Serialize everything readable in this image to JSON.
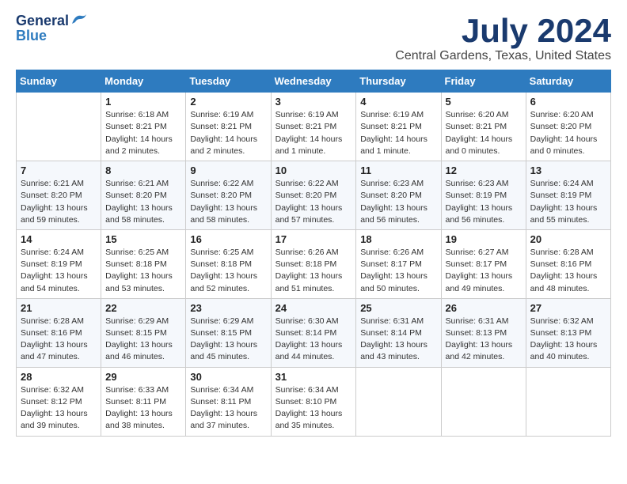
{
  "logo": {
    "line1": "General",
    "line2": "Blue"
  },
  "title": {
    "month_year": "July 2024",
    "location": "Central Gardens, Texas, United States"
  },
  "days_of_week": [
    "Sunday",
    "Monday",
    "Tuesday",
    "Wednesday",
    "Thursday",
    "Friday",
    "Saturday"
  ],
  "weeks": [
    [
      {
        "day": "",
        "sunrise": "",
        "sunset": "",
        "daylight": ""
      },
      {
        "day": "1",
        "sunrise": "Sunrise: 6:18 AM",
        "sunset": "Sunset: 8:21 PM",
        "daylight": "Daylight: 14 hours and 2 minutes."
      },
      {
        "day": "2",
        "sunrise": "Sunrise: 6:19 AM",
        "sunset": "Sunset: 8:21 PM",
        "daylight": "Daylight: 14 hours and 2 minutes."
      },
      {
        "day": "3",
        "sunrise": "Sunrise: 6:19 AM",
        "sunset": "Sunset: 8:21 PM",
        "daylight": "Daylight: 14 hours and 1 minute."
      },
      {
        "day": "4",
        "sunrise": "Sunrise: 6:19 AM",
        "sunset": "Sunset: 8:21 PM",
        "daylight": "Daylight: 14 hours and 1 minute."
      },
      {
        "day": "5",
        "sunrise": "Sunrise: 6:20 AM",
        "sunset": "Sunset: 8:21 PM",
        "daylight": "Daylight: 14 hours and 0 minutes."
      },
      {
        "day": "6",
        "sunrise": "Sunrise: 6:20 AM",
        "sunset": "Sunset: 8:20 PM",
        "daylight": "Daylight: 14 hours and 0 minutes."
      }
    ],
    [
      {
        "day": "7",
        "sunrise": "Sunrise: 6:21 AM",
        "sunset": "Sunset: 8:20 PM",
        "daylight": "Daylight: 13 hours and 59 minutes."
      },
      {
        "day": "8",
        "sunrise": "Sunrise: 6:21 AM",
        "sunset": "Sunset: 8:20 PM",
        "daylight": "Daylight: 13 hours and 58 minutes."
      },
      {
        "day": "9",
        "sunrise": "Sunrise: 6:22 AM",
        "sunset": "Sunset: 8:20 PM",
        "daylight": "Daylight: 13 hours and 58 minutes."
      },
      {
        "day": "10",
        "sunrise": "Sunrise: 6:22 AM",
        "sunset": "Sunset: 8:20 PM",
        "daylight": "Daylight: 13 hours and 57 minutes."
      },
      {
        "day": "11",
        "sunrise": "Sunrise: 6:23 AM",
        "sunset": "Sunset: 8:20 PM",
        "daylight": "Daylight: 13 hours and 56 minutes."
      },
      {
        "day": "12",
        "sunrise": "Sunrise: 6:23 AM",
        "sunset": "Sunset: 8:19 PM",
        "daylight": "Daylight: 13 hours and 56 minutes."
      },
      {
        "day": "13",
        "sunrise": "Sunrise: 6:24 AM",
        "sunset": "Sunset: 8:19 PM",
        "daylight": "Daylight: 13 hours and 55 minutes."
      }
    ],
    [
      {
        "day": "14",
        "sunrise": "Sunrise: 6:24 AM",
        "sunset": "Sunset: 8:19 PM",
        "daylight": "Daylight: 13 hours and 54 minutes."
      },
      {
        "day": "15",
        "sunrise": "Sunrise: 6:25 AM",
        "sunset": "Sunset: 8:18 PM",
        "daylight": "Daylight: 13 hours and 53 minutes."
      },
      {
        "day": "16",
        "sunrise": "Sunrise: 6:25 AM",
        "sunset": "Sunset: 8:18 PM",
        "daylight": "Daylight: 13 hours and 52 minutes."
      },
      {
        "day": "17",
        "sunrise": "Sunrise: 6:26 AM",
        "sunset": "Sunset: 8:18 PM",
        "daylight": "Daylight: 13 hours and 51 minutes."
      },
      {
        "day": "18",
        "sunrise": "Sunrise: 6:26 AM",
        "sunset": "Sunset: 8:17 PM",
        "daylight": "Daylight: 13 hours and 50 minutes."
      },
      {
        "day": "19",
        "sunrise": "Sunrise: 6:27 AM",
        "sunset": "Sunset: 8:17 PM",
        "daylight": "Daylight: 13 hours and 49 minutes."
      },
      {
        "day": "20",
        "sunrise": "Sunrise: 6:28 AM",
        "sunset": "Sunset: 8:16 PM",
        "daylight": "Daylight: 13 hours and 48 minutes."
      }
    ],
    [
      {
        "day": "21",
        "sunrise": "Sunrise: 6:28 AM",
        "sunset": "Sunset: 8:16 PM",
        "daylight": "Daylight: 13 hours and 47 minutes."
      },
      {
        "day": "22",
        "sunrise": "Sunrise: 6:29 AM",
        "sunset": "Sunset: 8:15 PM",
        "daylight": "Daylight: 13 hours and 46 minutes."
      },
      {
        "day": "23",
        "sunrise": "Sunrise: 6:29 AM",
        "sunset": "Sunset: 8:15 PM",
        "daylight": "Daylight: 13 hours and 45 minutes."
      },
      {
        "day": "24",
        "sunrise": "Sunrise: 6:30 AM",
        "sunset": "Sunset: 8:14 PM",
        "daylight": "Daylight: 13 hours and 44 minutes."
      },
      {
        "day": "25",
        "sunrise": "Sunrise: 6:31 AM",
        "sunset": "Sunset: 8:14 PM",
        "daylight": "Daylight: 13 hours and 43 minutes."
      },
      {
        "day": "26",
        "sunrise": "Sunrise: 6:31 AM",
        "sunset": "Sunset: 8:13 PM",
        "daylight": "Daylight: 13 hours and 42 minutes."
      },
      {
        "day": "27",
        "sunrise": "Sunrise: 6:32 AM",
        "sunset": "Sunset: 8:13 PM",
        "daylight": "Daylight: 13 hours and 40 minutes."
      }
    ],
    [
      {
        "day": "28",
        "sunrise": "Sunrise: 6:32 AM",
        "sunset": "Sunset: 8:12 PM",
        "daylight": "Daylight: 13 hours and 39 minutes."
      },
      {
        "day": "29",
        "sunrise": "Sunrise: 6:33 AM",
        "sunset": "Sunset: 8:11 PM",
        "daylight": "Daylight: 13 hours and 38 minutes."
      },
      {
        "day": "30",
        "sunrise": "Sunrise: 6:34 AM",
        "sunset": "Sunset: 8:11 PM",
        "daylight": "Daylight: 13 hours and 37 minutes."
      },
      {
        "day": "31",
        "sunrise": "Sunrise: 6:34 AM",
        "sunset": "Sunset: 8:10 PM",
        "daylight": "Daylight: 13 hours and 35 minutes."
      },
      {
        "day": "",
        "sunrise": "",
        "sunset": "",
        "daylight": ""
      },
      {
        "day": "",
        "sunrise": "",
        "sunset": "",
        "daylight": ""
      },
      {
        "day": "",
        "sunrise": "",
        "sunset": "",
        "daylight": ""
      }
    ]
  ]
}
